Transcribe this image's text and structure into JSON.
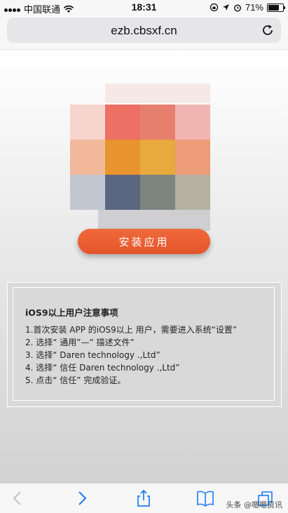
{
  "status_bar": {
    "carrier": "中国联通",
    "time": "18:31",
    "battery": "71%"
  },
  "browser": {
    "url": "ezb.cbsxf.cn"
  },
  "main": {
    "install_label": "安装应用",
    "notice": {
      "title": "iOS9以上用户注意事项",
      "items": [
        "1.首次安装 APP 的iOS9以上 用户，需要进入系统“设置”",
        "2. 选择“ 通用”—“ 描述文件”",
        "3. 选择“ Daren technology .,Ltd”",
        "4. 选择“ 信任 Daren technology .,Ltd”",
        "5. 点击“ 信任” 完成验证。"
      ]
    }
  },
  "toolbar": {
    "icons": [
      "back-icon",
      "forward-icon",
      "share-icon",
      "bookmarks-icon",
      "tabs-icon"
    ]
  },
  "watermark": "头条 @嗯嗯资讯",
  "colors": {
    "accent": "#e85a2e",
    "ios_blue": "#1b7cf5"
  }
}
